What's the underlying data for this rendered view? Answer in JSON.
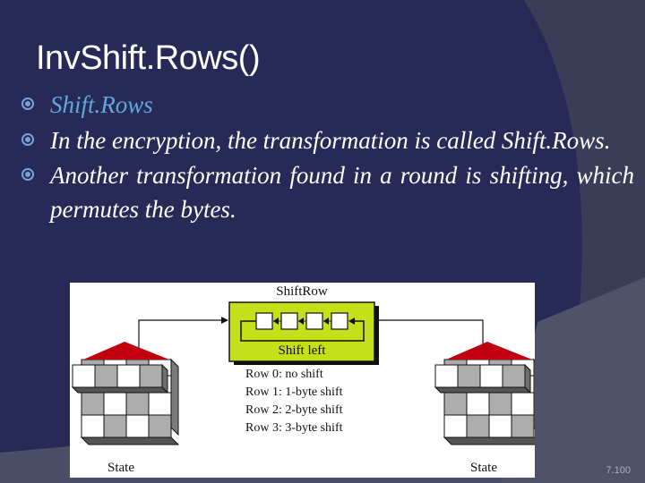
{
  "slide": {
    "title": "InvShift.Rows()",
    "bullets": [
      "Shift.Rows",
      "In the encryption, the transformation is called Shift.Rows.",
      "Another transformation found in a round is shifting, which permutes the bytes."
    ],
    "page_number": "7.100"
  },
  "figure": {
    "title": "ShiftRow",
    "box_label": "Shift left",
    "row_notes": [
      "Row 0: no shift",
      "Row 1: 1-byte shift",
      "Row 2: 2-byte shift",
      "Row 3: 3-byte shift"
    ],
    "left_label": "State",
    "right_label": "State"
  },
  "colors": {
    "background": "#272a56",
    "accent_band": "#3c3f58",
    "bullet_accent": "#5fa8e0",
    "shift_box": "#c4e01a",
    "arrow_red": "#c0000f"
  }
}
